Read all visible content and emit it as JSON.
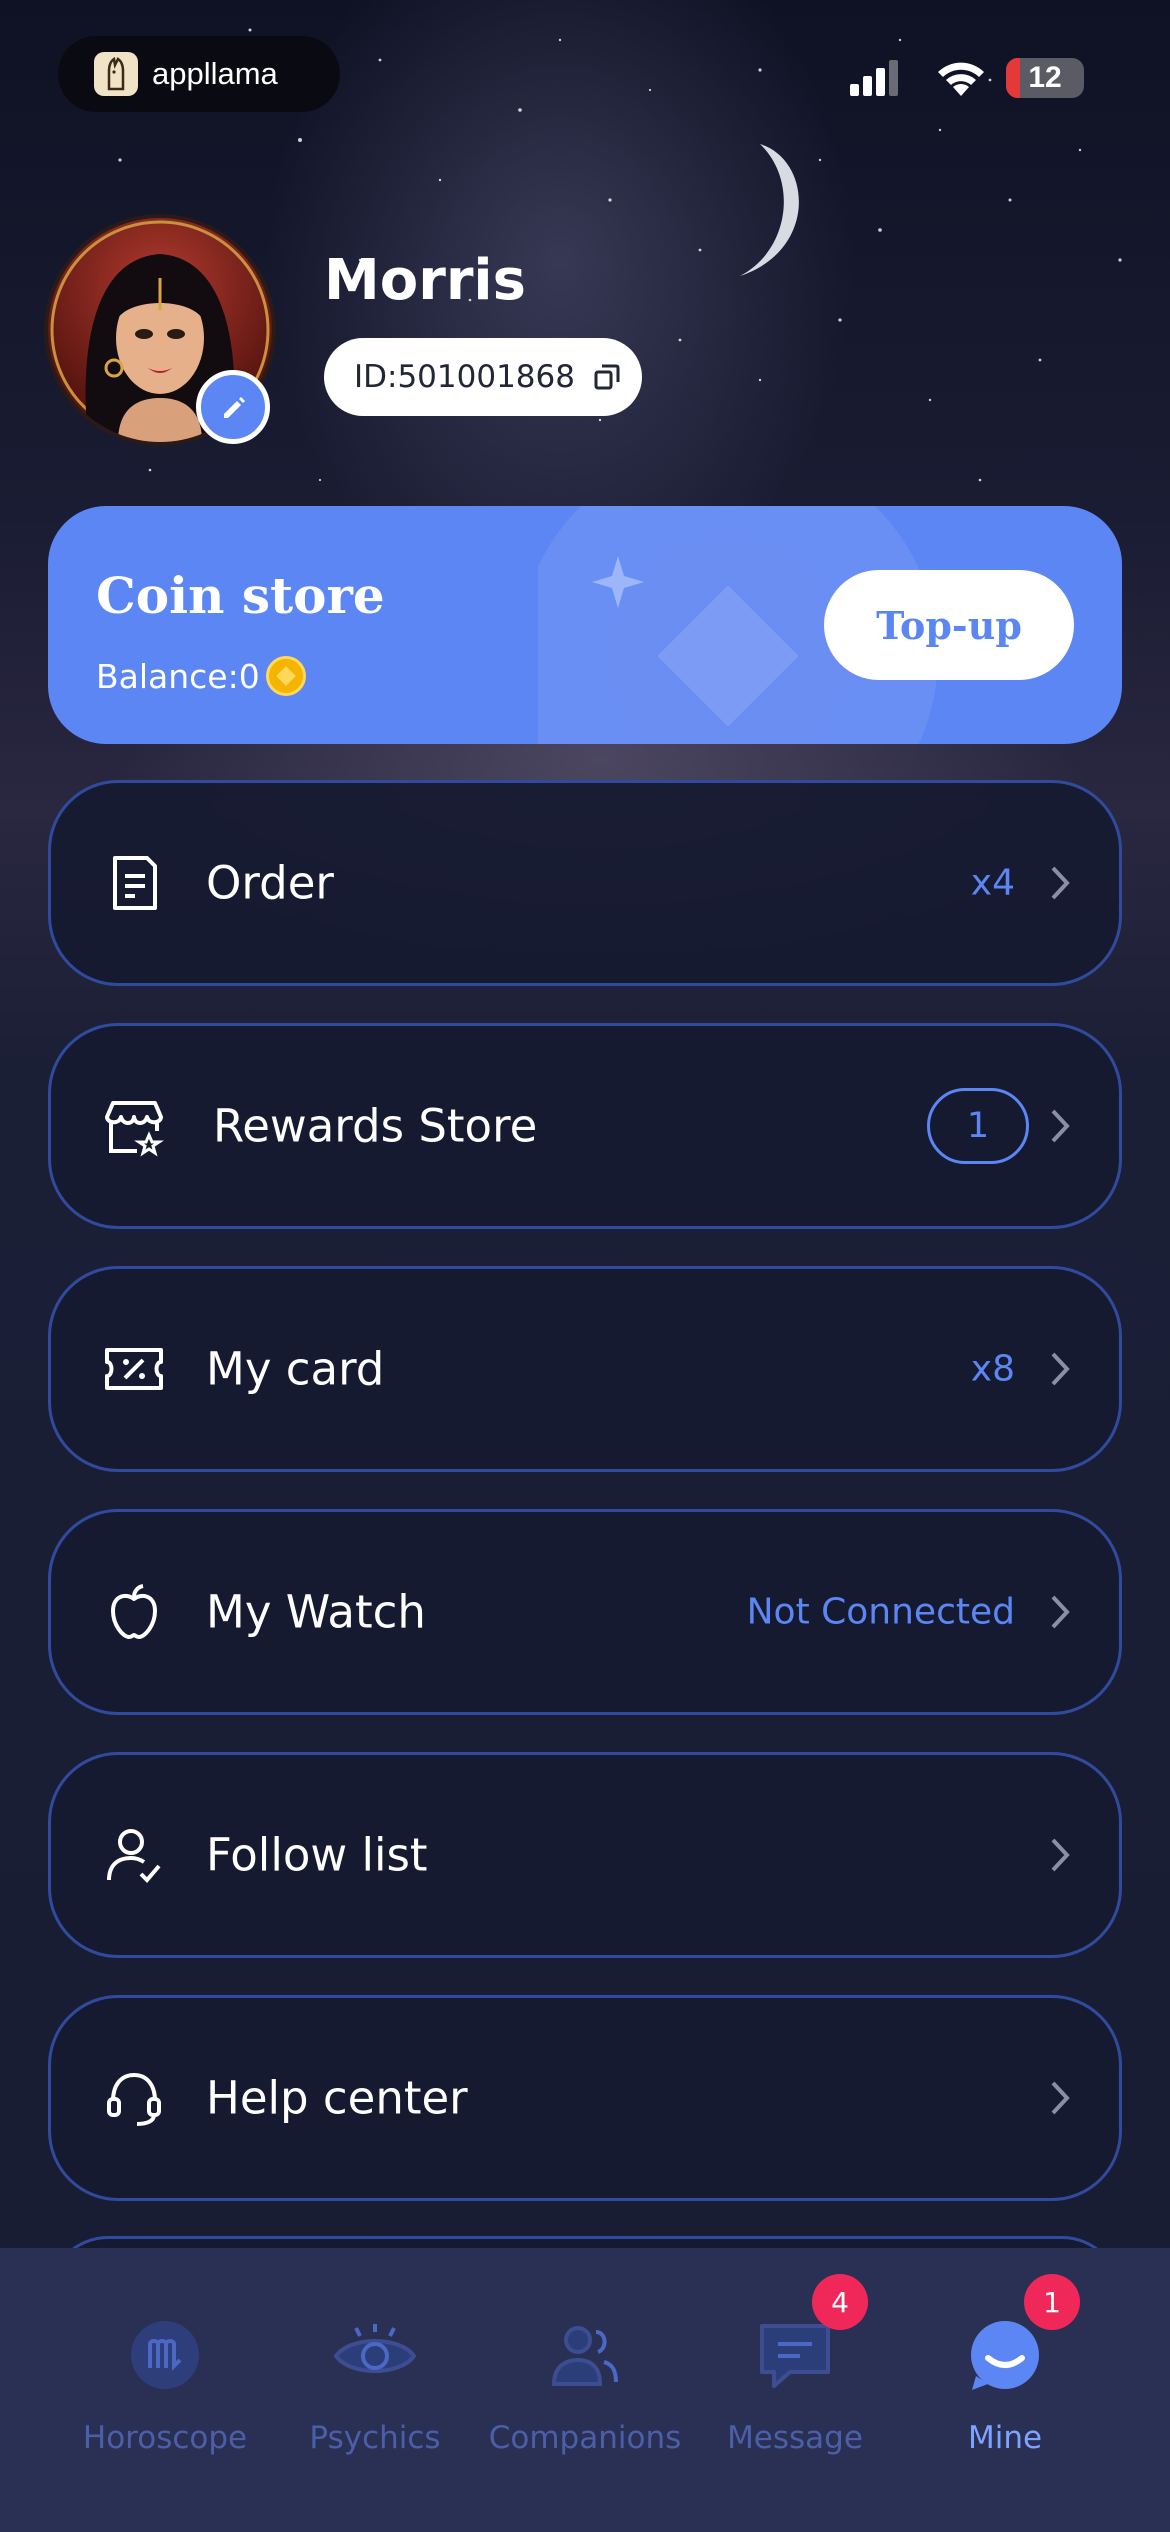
{
  "status_bar": {
    "app_name": "appllama",
    "battery": "12"
  },
  "profile": {
    "name": "Morris",
    "id_text": "ID:501001868"
  },
  "coin_store": {
    "title": "Coin store",
    "balance_text": "Balance:0",
    "topup_label": "Top-up",
    "accent": "#5b86f4"
  },
  "menu": {
    "order": {
      "label": "Order",
      "value": "x4",
      "icon": "receipt-icon"
    },
    "rewards": {
      "label": "Rewards Store",
      "badge": "1",
      "icon": "store-icon"
    },
    "card": {
      "label": "My card",
      "value": "x8",
      "icon": "coupon-icon"
    },
    "watch": {
      "label": "My Watch",
      "value": "Not Connected",
      "icon": "apple-icon"
    },
    "follow": {
      "label": "Follow list",
      "icon": "user-check-icon"
    },
    "help": {
      "label": "Help center",
      "icon": "headset-icon"
    }
  },
  "tabs": [
    {
      "label": "Horoscope",
      "icon": "scorpio-icon"
    },
    {
      "label": "Psychics",
      "icon": "eye-icon"
    },
    {
      "label": "Companions",
      "icon": "people-icon"
    },
    {
      "label": "Message",
      "icon": "chat-icon",
      "badge": "4"
    },
    {
      "label": "Mine",
      "icon": "smile-bubble-icon",
      "badge": "1",
      "active": true
    }
  ]
}
